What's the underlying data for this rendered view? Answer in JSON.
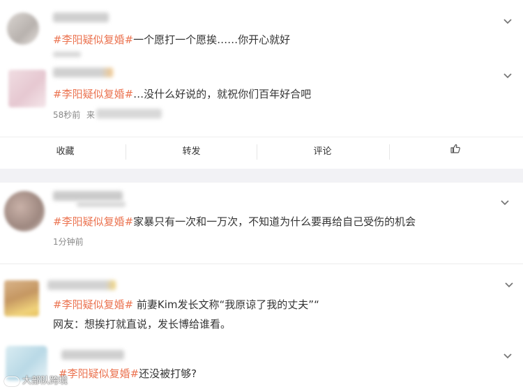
{
  "comments": [
    {
      "hashtag": "#李阳疑似复婚#",
      "text": "一个愿打一个愿挨……你开心就好"
    },
    {
      "hashtag": "#李阳疑似复婚#",
      "text": "…没什么好说的，就祝你们百年好合吧",
      "time": "58秒前",
      "source_prefix": "来"
    },
    {
      "hashtag": "#李阳疑似复婚#",
      "text": "家暴只有一次和一万次，不知道为什么要再给自己受伤的机会",
      "time": "1分钟前"
    },
    {
      "hashtag": "#李阳疑似复婚#",
      "text": " 前妻Kim发长文称“我原谅了我的丈夫”“",
      "line2": "网友：想挨打就直说，发长博给谁看。"
    },
    {
      "hashtag": "#李阳疑似复婚#",
      "text": "还没被打够?"
    }
  ],
  "actions": {
    "repost_label": "收藏",
    "forward_label": "转发",
    "comment_label": "评论",
    "like_icon": "thumbs-up-icon"
  },
  "watermark": {
    "text": "大部队跨境",
    "icon": "watermark-logo-icon"
  },
  "colors": {
    "hashtag": "#eb7350",
    "divider": "#f2f2f5",
    "meta": "#888888"
  }
}
